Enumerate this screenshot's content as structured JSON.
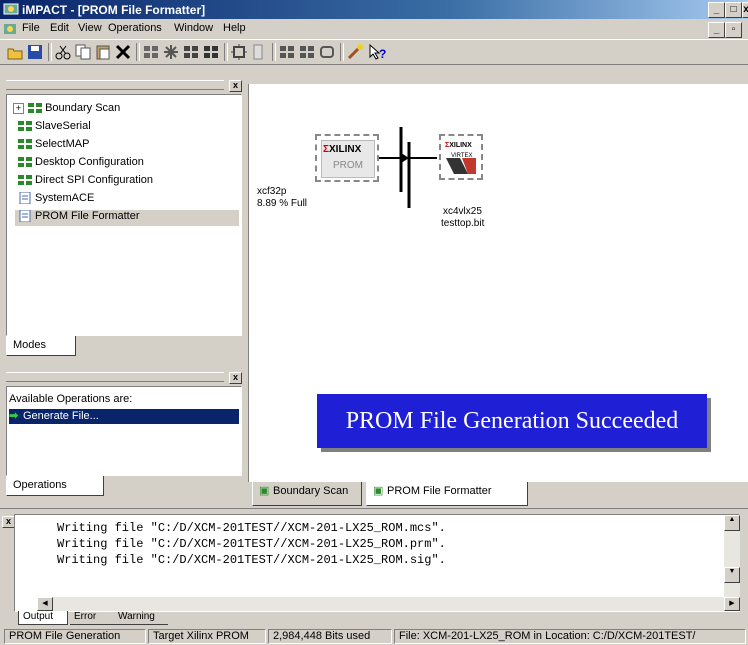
{
  "window": {
    "title": "iMPACT - [PROM File Formatter]"
  },
  "menu": [
    "File",
    "Edit",
    "View",
    "Operations",
    "Window",
    "Help"
  ],
  "modes_panel": {
    "items": [
      "Boundary Scan",
      "SlaveSerial",
      "SelectMAP",
      "Desktop Configuration",
      "Direct SPI Configuration",
      "SystemACE",
      "PROM File Formatter"
    ],
    "tab": "Modes"
  },
  "operations_panel": {
    "header": "Available Operations are:",
    "items": [
      "Generate File..."
    ],
    "tab": "Operations"
  },
  "canvas": {
    "prom_device": {
      "brand": "XILINX",
      "type": "PROM",
      "name": "xcf32p",
      "fill": "8.89 % Full"
    },
    "fpga_device": {
      "brand": "XILINX",
      "family": "VIRTEX",
      "name": "xc4vlx25",
      "file": "testtop.bit"
    },
    "banner": "PROM File Generation Succeeded"
  },
  "view_tabs": [
    "Boundary Scan",
    "PROM File Formatter"
  ],
  "console": {
    "lines": [
      "Writing file \"C:/D/XCM-201TEST//XCM-201-LX25_ROM.mcs\".",
      "Writing file \"C:/D/XCM-201TEST//XCM-201-LX25_ROM.prm\".",
      "Writing file \"C:/D/XCM-201TEST//XCM-201-LX25_ROM.sig\"."
    ],
    "tabs": [
      "Output",
      "Error",
      "Warning"
    ]
  },
  "status": {
    "mode": "PROM File Generation",
    "target": "Target Xilinx PROM",
    "bits": "2,984,448 Bits used",
    "file": "File: XCM-201-LX25_ROM in Location: C:/D/XCM-201TEST/"
  },
  "colors": {
    "banner_bg": "#1f1fd6",
    "selection": "#0a246a",
    "title_bar": "#0a246a"
  }
}
